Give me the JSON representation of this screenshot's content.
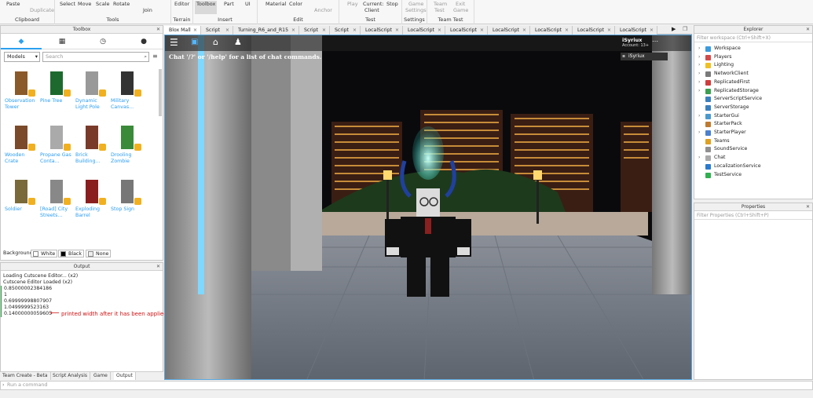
{
  "ribbon": {
    "clipboard": {
      "paste": "Paste",
      "duplicate": "Duplicate",
      "label": "Clipboard"
    },
    "tools": {
      "select": "Select",
      "move": "Move",
      "scale": "Scale",
      "rotate": "Rotate",
      "join": "Join",
      "label": "Tools"
    },
    "terrain": {
      "editor": "Editor",
      "label": "Terrain"
    },
    "insert": {
      "toolbox": "Toolbox",
      "part": "Part",
      "ui": "UI",
      "label": "Insert"
    },
    "edit": {
      "material": "Material",
      "color": "Color",
      "anchor": "Anchor",
      "label": "Edit"
    },
    "test": {
      "play": "Play",
      "current_client_1": "Current:",
      "current_client_2": "Client",
      "stop": "Stop",
      "label": "Test"
    },
    "settings": {
      "game_1": "Game",
      "game_2": "Settings",
      "label": "Settings"
    },
    "team_test": {
      "team_1": "Team",
      "team_2": "Test",
      "exit_1": "Exit",
      "exit_2": "Game",
      "label": "Team Test"
    }
  },
  "toolbox": {
    "title": "Toolbox",
    "category": "Models",
    "search_placeholder": "Search",
    "items": [
      {
        "name": "Observation Tower"
      },
      {
        "name": "Pine Tree"
      },
      {
        "name": "Dynamic Light Pole"
      },
      {
        "name": "Military Canvas..."
      },
      {
        "name": "Wooden Crate"
      },
      {
        "name": "Propane Gas Conta..."
      },
      {
        "name": "Brick Building..."
      },
      {
        "name": "Drooling Zombie"
      },
      {
        "name": "Soldier"
      },
      {
        "name": "[Road] City Streets..."
      },
      {
        "name": "Exploding Barrel"
      },
      {
        "name": "Stop Sign"
      }
    ],
    "background_label": "Background:",
    "bg_white": "White",
    "bg_black": "Black",
    "bg_none": "None"
  },
  "output": {
    "title": "Output",
    "lines": [
      "Loading Cutscene Editor... (x2)",
      "Cutscene Editor Loaded (x2)",
      "0.85000002384186",
      "1",
      "0.69999998807907",
      "1.0499999523163",
      "0.14000000059605"
    ],
    "annotation": "printed width after it has been applied"
  },
  "bottom_tabs": [
    "Team Create - Beta",
    "Script Analysis",
    "Game",
    "Output"
  ],
  "command_placeholder": "Run a command",
  "doc_tabs": [
    "Blox Mall",
    "Script",
    "Turning_R6_and_R15",
    "Script",
    "Script",
    "LocalScript",
    "LocalScript",
    "LocalScript",
    "LocalScript",
    "LocalScript",
    "LocalScript",
    "LocalScript"
  ],
  "game": {
    "chat_hint": "Chat '/?' or '/help' for a list of chat commands.",
    "username": "iSyriux",
    "account": "Account: 13+",
    "player_list_name": "iSyriux"
  },
  "explorer": {
    "title": "Explorer",
    "filter_placeholder": "Filter workspace (Ctrl+Shift+X)",
    "items": [
      {
        "name": "Workspace",
        "color": "#3a9be0",
        "arrow": true
      },
      {
        "name": "Players",
        "color": "#d44a4a",
        "arrow": true
      },
      {
        "name": "Lighting",
        "color": "#f0c020",
        "arrow": true
      },
      {
        "name": "NetworkClient",
        "color": "#7a7a7a",
        "arrow": true
      },
      {
        "name": "ReplicatedFirst",
        "color": "#d03c3c",
        "arrow": true
      },
      {
        "name": "ReplicatedStorage",
        "color": "#3aa050",
        "arrow": true
      },
      {
        "name": "ServerScriptService",
        "color": "#3a80c0",
        "arrow": false
      },
      {
        "name": "ServerStorage",
        "color": "#3a80c0",
        "arrow": false
      },
      {
        "name": "StarterGui",
        "color": "#4a9ad0",
        "arrow": true
      },
      {
        "name": "StarterPack",
        "color": "#c07a30",
        "arrow": false
      },
      {
        "name": "StarterPlayer",
        "color": "#4a80d0",
        "arrow": true
      },
      {
        "name": "Teams",
        "color": "#e0a020",
        "arrow": false
      },
      {
        "name": "SoundService",
        "color": "#909090",
        "arrow": false
      },
      {
        "name": "Chat",
        "color": "#aaaaaa",
        "arrow": true
      },
      {
        "name": "LocalizationService",
        "color": "#2a7ad0",
        "arrow": false
      },
      {
        "name": "TestService",
        "color": "#30b050",
        "arrow": false
      }
    ]
  },
  "properties": {
    "title": "Properties",
    "filter_placeholder": "Filter Properties (Ctrl+Shift+P)"
  },
  "colors": {
    "accent": "#2aa0f0",
    "annotation_red": "#d01010"
  }
}
